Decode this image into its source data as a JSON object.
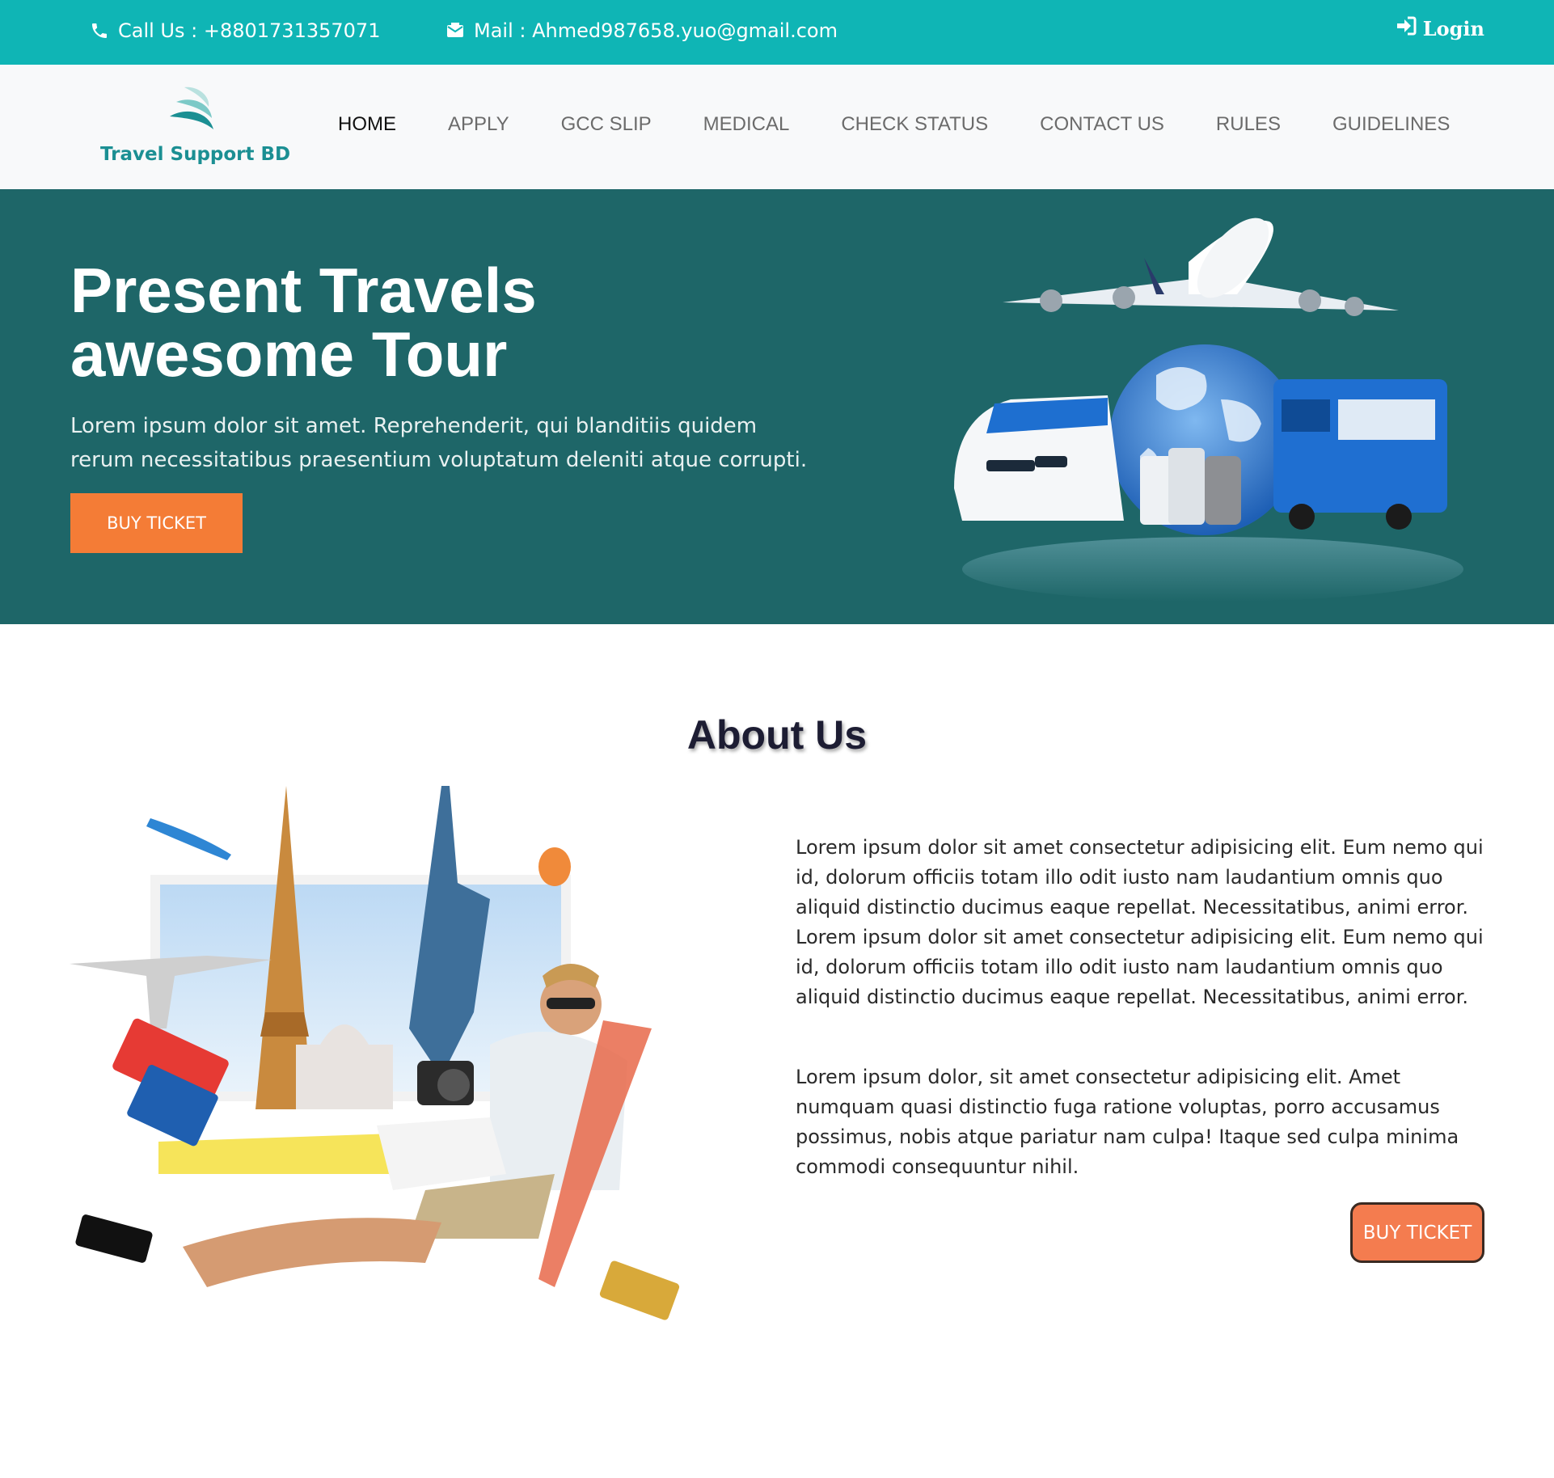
{
  "topbar": {
    "phone": "Call Us : +8801731357071",
    "mail": "Mail : Ahmed987658.yuo@gmail.com",
    "login": "Login"
  },
  "brand": {
    "name": "Travel Support BD"
  },
  "nav": {
    "items": [
      "HOME",
      "APPLY",
      "GCC SLIP",
      "MEDICAL",
      "CHECK STATUS",
      "CONTACT US",
      "RULES",
      "GUIDELINES"
    ],
    "active": "HOME"
  },
  "hero": {
    "title_line1": "Present Travels",
    "title_line2": "awesome Tour",
    "text": "Lorem ipsum dolor sit amet. Reprehenderit, qui blanditiis quidem rerum necessitatibus praesentium voluptatum deleniti atque corrupti.",
    "button": "BUY TICKET"
  },
  "about": {
    "title": "About Us",
    "paragraph1": " Lorem ipsum dolor sit amet consectetur adipisicing elit. Eum nemo qui id, dolorum officiis totam illo odit iusto nam laudantium omnis quo aliquid distinctio ducimus eaque repellat. Necessitatibus, animi error. Lorem ipsum dolor sit amet consectetur adipisicing elit. Eum nemo qui id, dolorum officiis totam illo odit iusto nam laudantium omnis quo aliquid distinctio ducimus eaque repellat. Necessitatibus, animi error.",
    "paragraph2": "Lorem ipsum dolor, sit amet consectetur adipisicing elit. Amet numquam quasi distinctio fuga ratione voluptas, porro accusamus possimus, nobis atque pariatur nam culpa! Itaque sed culpa minima commodi consequuntur nihil.",
    "button": "BUY TICKET"
  },
  "colors": {
    "topbar": "#0fb5b5",
    "hero_bg": "#1e6668",
    "accent": "#f47c36",
    "brand_teal": "#1b8f93"
  },
  "icons": [
    "phone-icon",
    "mail-icon",
    "login-icon",
    "logo-wave-icon"
  ]
}
